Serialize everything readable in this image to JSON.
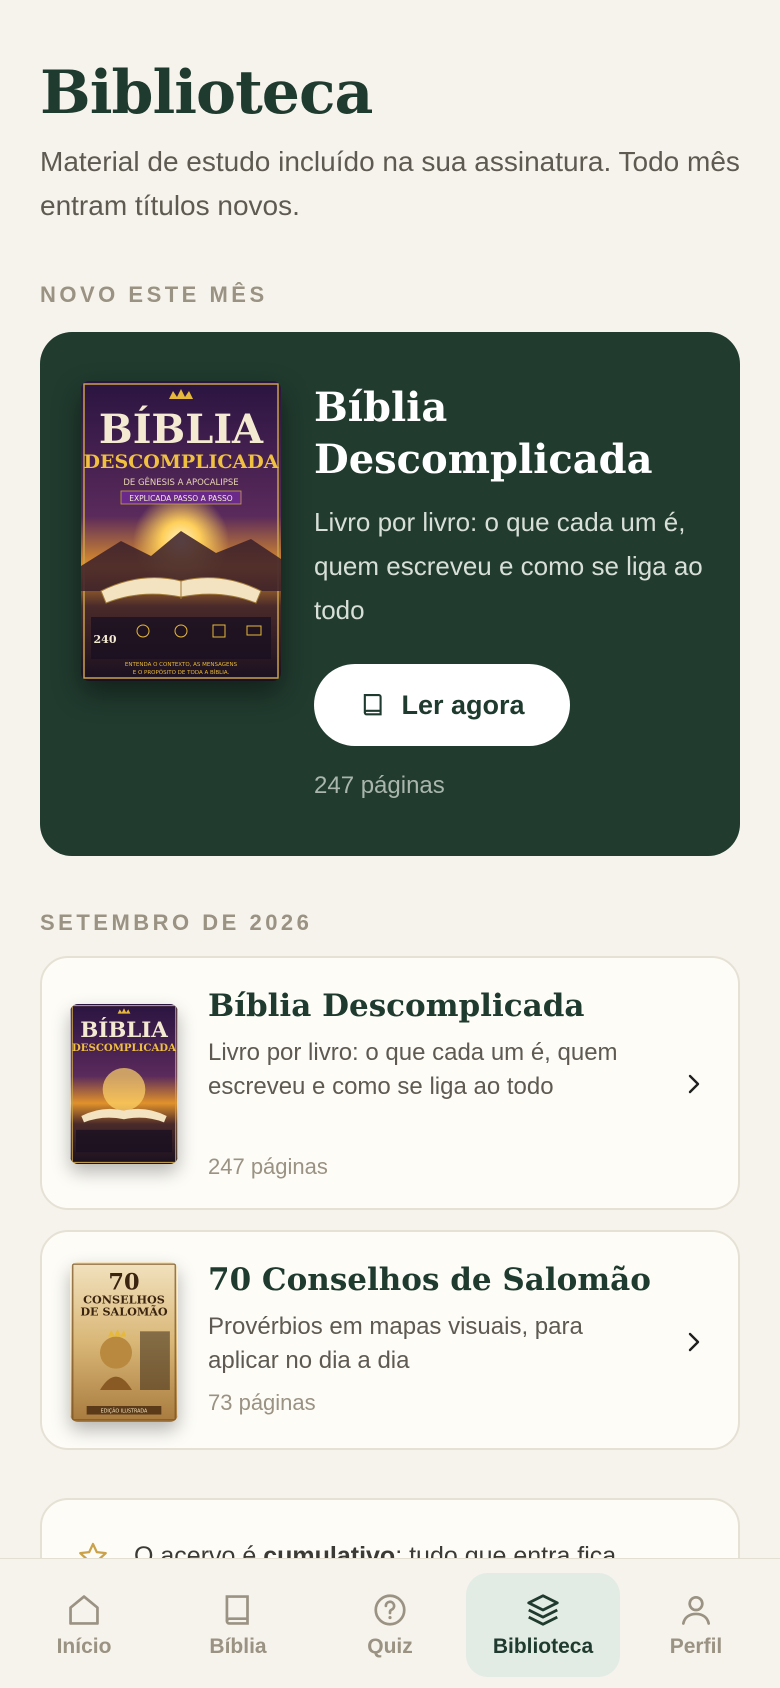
{
  "page": {
    "title": "Biblioteca",
    "subtitle": "Material de estudo incluído na sua assinatura. Todo mês entram títulos novos."
  },
  "featured": {
    "section_label": "NOVO ESTE MÊS",
    "title": "Bíblia Descomplicada",
    "description": "Livro por livro: o que cada um é, quem escreveu e como se liga ao todo",
    "button_label": "Ler agora",
    "pages": "247 páginas",
    "cover": {
      "title_line1": "BÍBLIA",
      "title_line2": "DESCOMPLICADA",
      "subtitle": "DE GÊNESIS A APOCALIPSE",
      "ribbon": "EXPLICADA PASSO A PASSO",
      "footer_line1": "ENTENDA O CONTEXTO, AS MENSAGENS",
      "footer_line2": "E O PROPÓSITO DE TODA A BÍBLIA.",
      "stat_number": "240"
    }
  },
  "month_section": {
    "label": "SETEMBRO DE 2026",
    "items": [
      {
        "title": "Bíblia Descomplicada",
        "description": "Livro por livro: o que cada um é, quem escreveu e como se liga ao todo",
        "pages": "247 páginas"
      },
      {
        "title": "70 Conselhos de Salomão",
        "description": "Provérbios em mapas visuais, para aplicar no dia a dia",
        "pages": "73 páginas",
        "cover": {
          "number": "70",
          "line1": "CONSELHOS",
          "line2": "DE SALOMÃO",
          "edition": "EDIÇÃO ILUSTRADA"
        }
      }
    ]
  },
  "info": {
    "text_before": "O acervo é ",
    "text_bold": "cumulativo",
    "text_after": ": tudo que entra fica disponível enquanto sua assinatura estiver ativa."
  },
  "tabbar": {
    "tabs": [
      {
        "label": "Início",
        "icon": "home-icon"
      },
      {
        "label": "Bíblia",
        "icon": "book-icon"
      },
      {
        "label": "Quiz",
        "icon": "question-circle-icon"
      },
      {
        "label": "Biblioteca",
        "icon": "layers-icon"
      },
      {
        "label": "Perfil",
        "icon": "user-icon"
      }
    ],
    "active": "Biblioteca"
  },
  "colors": {
    "background": "#f6f3ec",
    "primary_green": "#213b2f",
    "active_tab_bg": "#e2ebe4",
    "muted": "#9a9282"
  }
}
